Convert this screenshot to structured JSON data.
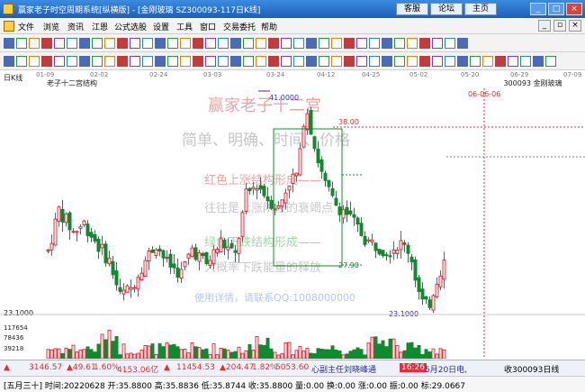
{
  "window": {
    "title": "赢家老子时空周期系统[纵横版] - [金刚玻璃  SZ300093-117日K线]",
    "buttons": [
      "客服",
      "论坛",
      "主页"
    ],
    "controls": [
      "_",
      "□",
      "×"
    ]
  },
  "menu": {
    "items": [
      "文件",
      "浏览",
      "资讯",
      "江恩",
      "公式选股",
      "设置",
      "工具",
      "窗口",
      "交易委托",
      "帮助"
    ],
    "controls": [
      "_",
      "▫",
      "×"
    ]
  },
  "chart": {
    "period_label": "日K线",
    "indicator_label": "老子十二宫结构",
    "stock_label": "300093  金刚玻璃",
    "x_ticks": [
      "01-09",
      "02-02",
      "02-24",
      "03-03",
      "03-24",
      "04-12",
      "04-25",
      "05-02",
      "05-20",
      "06-29",
      "07-09"
    ],
    "date_marker": "06-06",
    "date_marker_full": "06-06-06",
    "price_labels": {
      "high": "41.0000",
      "level_38": "38.00",
      "level_27": "27.90",
      "low": "23.1000",
      "left_low": "23.1000"
    },
    "volume_ticks": [
      "117654",
      "78436",
      "39218"
    ],
    "watermarks": {
      "brand": "赢家老子十二宫",
      "line1": "简单、明确、时间、价格",
      "line2": "红色上涨结构形成——",
      "line3": "往往是上涨阶段的衰竭点",
      "line4": "绿色下跌结构形成——",
      "line5": "大概率下跌能量的释放",
      "line6": "使用详情，请联系QQ:1008000000"
    },
    "colors": {
      "up": "#e0303c",
      "down": "#0c8c2c",
      "box": "#0c8c2c",
      "text_red": "#e0303c"
    }
  },
  "chart_data": {
    "type": "candlestick",
    "title": "老子十二宫结构",
    "price_high": 41.0,
    "price_low": 23.1,
    "levels": [
      38.0,
      27.9
    ]
  },
  "status1": {
    "sh_index": "3146.57",
    "sh_change": "▲49.61",
    "sh_pct": "1.60%",
    "sh_amount": "4153.06亿",
    "sz_index": "11454.53",
    "sz_change": "▲204.47",
    "sz_pct": "1.82%",
    "sz_amount": "5053.60",
    "ticker_msg": "心副主任刘晓峰通",
    "time": "16:26",
    "news": "5月20日电,",
    "right_label": "收300093日线"
  },
  "status2": {
    "text": "[五月三十] 时间:20220628 开:35.8800 高:35.8836 低:35.8744 收:35.8800 量:0.00 换:0.00 涨:0.00 振:0.00 标:29.0667"
  }
}
